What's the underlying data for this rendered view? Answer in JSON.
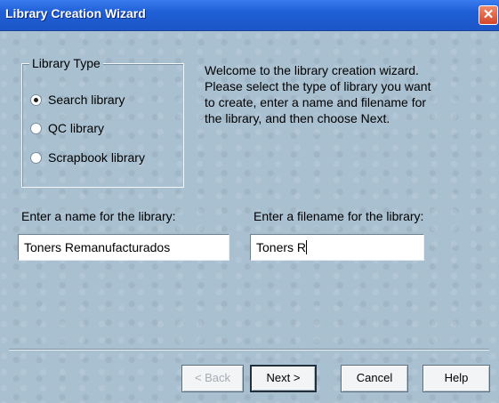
{
  "window": {
    "title": "Library Creation Wizard",
    "close_glyph": "✕"
  },
  "library_type": {
    "legend": "Library Type",
    "options": [
      {
        "label": "Search library",
        "selected": true
      },
      {
        "label": "QC library",
        "selected": false
      },
      {
        "label": "Scrapbook library",
        "selected": false
      }
    ]
  },
  "welcome_text": "Welcome to the library creation wizard.  Please select the type of library you want to create, enter a name and filename for the library, and then choose Next.",
  "name_field": {
    "label": "Enter a name for the library:",
    "value": "Toners Remanufacturados"
  },
  "filename_field": {
    "label": "Enter a filename for the library:",
    "value": "Toners R"
  },
  "buttons": {
    "back": "< Back",
    "next": "Next >",
    "cancel": "Cancel",
    "help": "Help"
  }
}
